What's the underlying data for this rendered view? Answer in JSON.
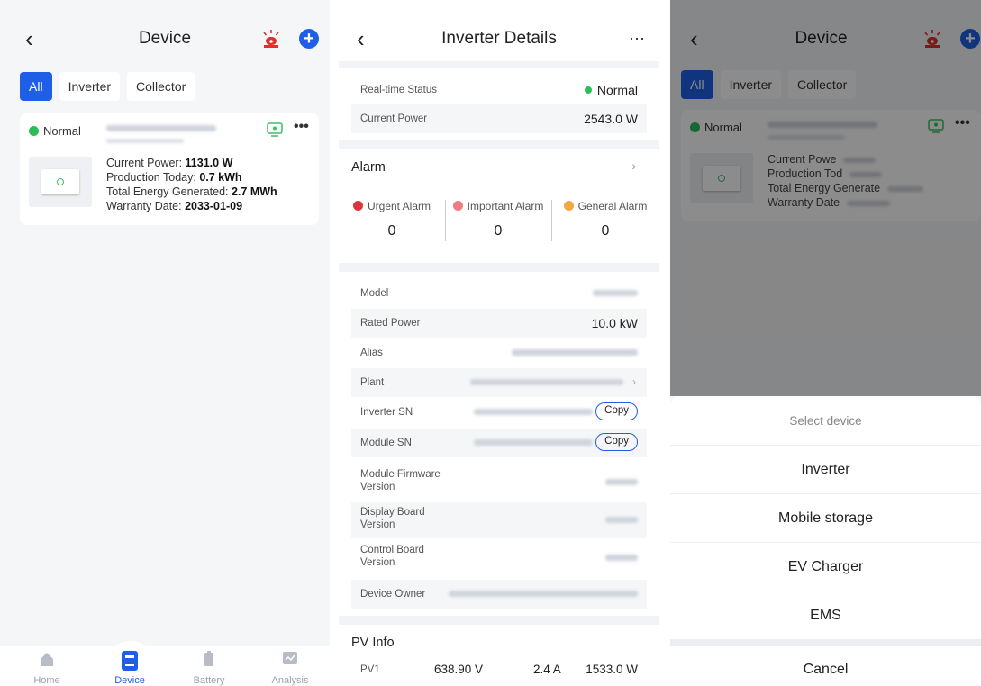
{
  "list_screen": {
    "title": "Device",
    "filters": [
      "All",
      "Inverter",
      "Collector"
    ],
    "card": {
      "status": "Normal",
      "current_power_label": "Current Power:",
      "current_power": "1131.0 W",
      "production_today_label": "Production Today:",
      "production_today": "0.7 kWh",
      "total_energy_label": "Total Energy Generated:",
      "total_energy": "2.7 MWh",
      "warranty_label": "Warranty Date:",
      "warranty_date": "2033-01-09"
    },
    "nav": [
      "Home",
      "Device",
      "Battery",
      "Analysis"
    ]
  },
  "detail_screen": {
    "title": "Inverter Details",
    "more": "···",
    "realtime_status_label": "Real-time Status",
    "realtime_status": "Normal",
    "current_power_label": "Current Power",
    "current_power": "2543.0 W",
    "alarm_title": "Alarm",
    "alarms": [
      {
        "label": "Urgent Alarm",
        "value": "0",
        "color": "#d9363e"
      },
      {
        "label": "Important Alarm",
        "value": "0",
        "color": "#f07c82"
      },
      {
        "label": "General Alarm",
        "value": "0",
        "color": "#f5a742"
      }
    ],
    "fields": {
      "model": "Model",
      "rated_power": "Rated Power",
      "rated_power_value": "10.0 kW",
      "alias": "Alias",
      "plant": "Plant",
      "inverter_sn": "Inverter SN",
      "module_sn": "Module SN",
      "module_fw_1": "Module Firmware",
      "module_fw_2": "Version",
      "display_board_1": "Display Board",
      "display_board_2": "Version",
      "control_board_1": "Control Board",
      "control_board_2": "Version",
      "device_owner": "Device Owner",
      "copy": "Copy"
    },
    "pv_title": "PV Info",
    "pv_rows": [
      {
        "name": "PV1",
        "voltage": "638.90 V",
        "current": "2.4 A",
        "power": "1533.0 W"
      }
    ]
  },
  "select_screen": {
    "sheet_title": "Select device",
    "options": [
      "Inverter",
      "Mobile storage",
      "EV Charger",
      "EMS"
    ],
    "cancel": "Cancel"
  },
  "colors": {
    "accent": "#1f5fe8",
    "normal": "#2bbd5a"
  }
}
